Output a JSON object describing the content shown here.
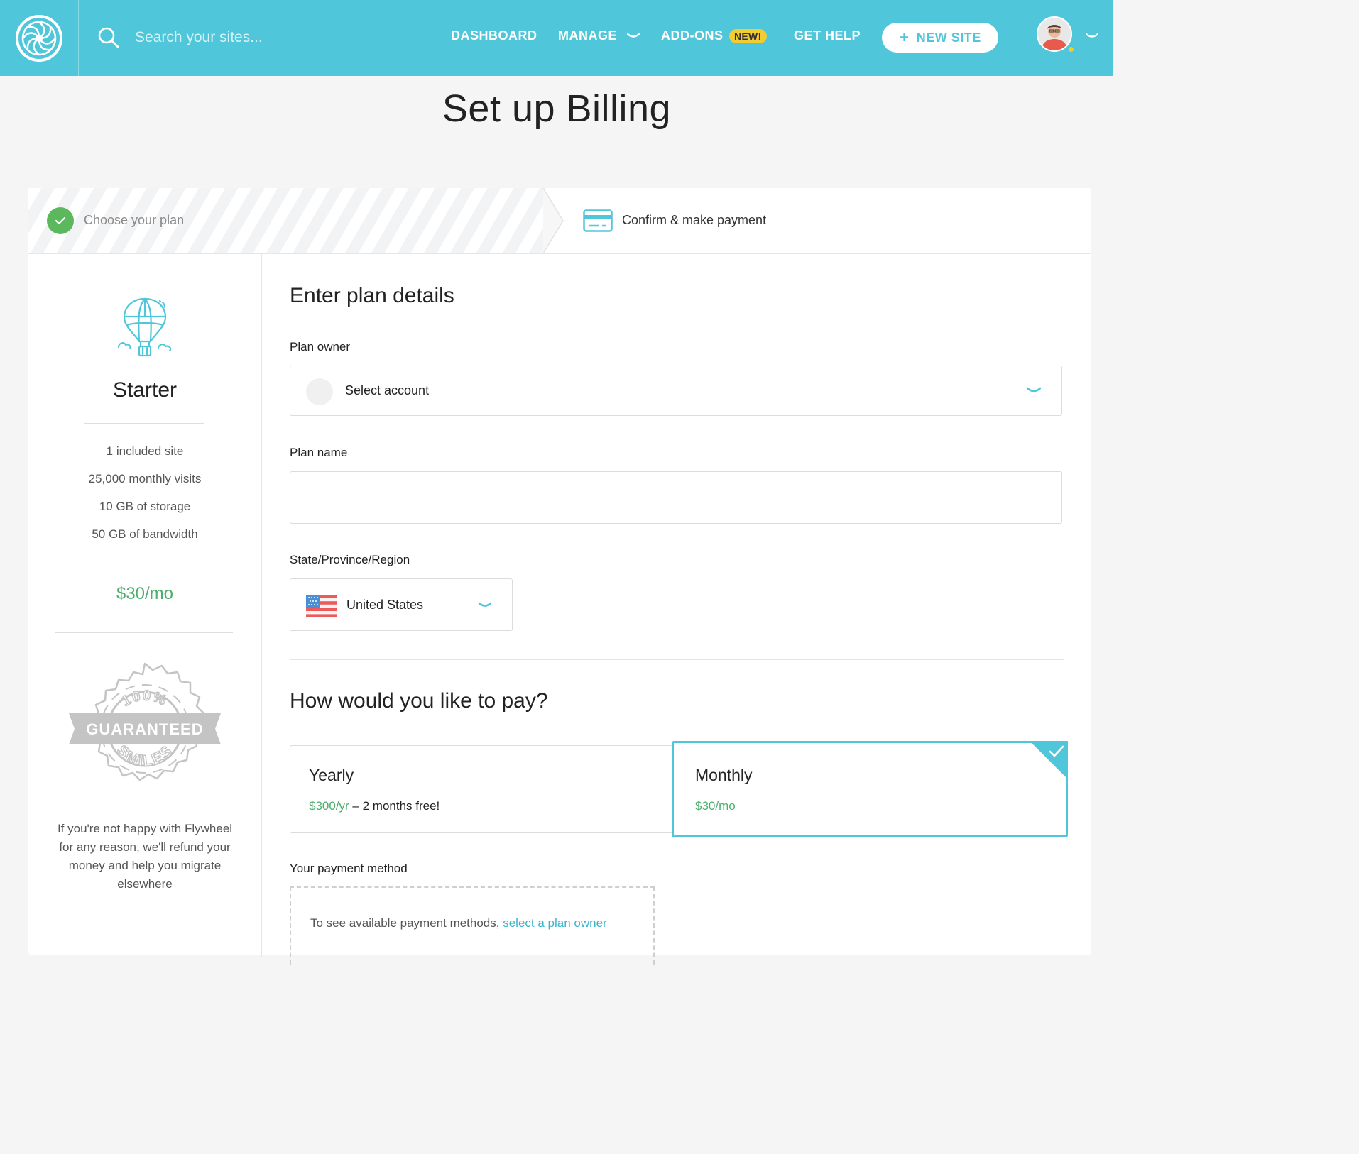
{
  "header": {
    "search_placeholder": "Search your sites...",
    "nav": {
      "dashboard": "DASHBOARD",
      "manage": "MANAGE",
      "addons": "ADD-ONS",
      "addons_badge": "NEW!",
      "get_help": "GET HELP"
    },
    "new_site_label": "NEW SITE"
  },
  "page": {
    "title": "Set up Billing"
  },
  "steps": {
    "step1": {
      "label": "Choose your plan",
      "status": "complete"
    },
    "step2": {
      "label": "Confirm & make payment",
      "status": "active"
    }
  },
  "plan": {
    "name": "Starter",
    "features": [
      "1 included site",
      "25,000 monthly visits",
      "10 GB of storage",
      "50 GB of bandwidth"
    ],
    "price": "$30/mo"
  },
  "guarantee": {
    "seal_top": "100%",
    "seal_banner": "GUARANTEED",
    "seal_bottom": "SMILES",
    "text": "If you're not happy with Flywheel for any reason, we'll refund your money and help you migrate elsewhere"
  },
  "form": {
    "section_title": "Enter plan details",
    "plan_owner": {
      "label": "Plan owner",
      "value": "Select account"
    },
    "plan_name": {
      "label": "Plan name",
      "value": ""
    },
    "region": {
      "label": "State/Province/Region",
      "value": "United States"
    }
  },
  "payment": {
    "section_title": "How would you like to pay?",
    "options": [
      {
        "title": "Yearly",
        "price": "$300/yr",
        "note": " – 2 months free!",
        "selected": false
      },
      {
        "title": "Monthly",
        "price": "$30/mo",
        "note": "",
        "selected": true
      }
    ],
    "method_label": "Your payment method",
    "method_text": "To see available payment methods, ",
    "method_link": "select a plan owner"
  },
  "colors": {
    "brand": "#50c6db",
    "success": "#5cb85c",
    "price_green": "#4caf6d",
    "badge_yellow": "#f2cc30"
  },
  "icons": [
    "flywheel-logo-icon",
    "search-icon",
    "chevron-down-icon",
    "plus-icon",
    "check-icon",
    "credit-card-icon",
    "hot-air-balloon-icon",
    "us-flag-icon",
    "guarantee-seal-icon"
  ]
}
